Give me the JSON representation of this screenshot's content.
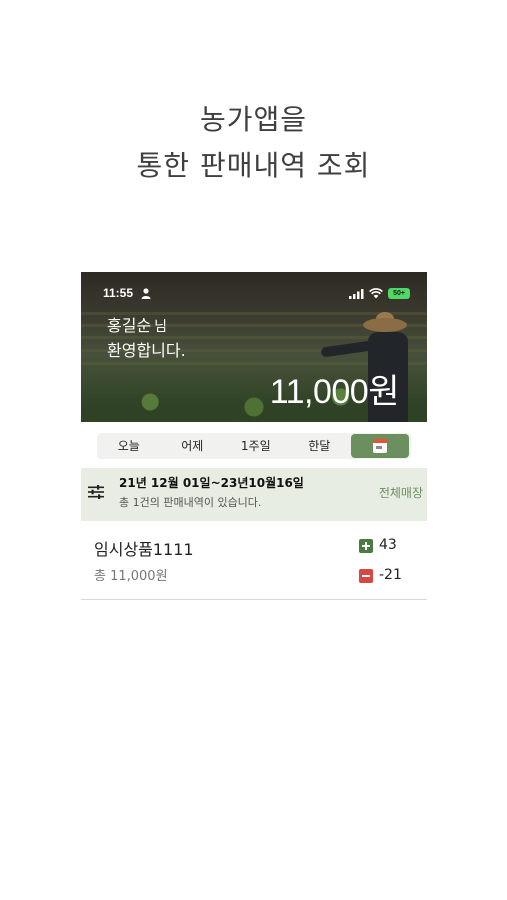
{
  "promo": {
    "line1": "농가앱을",
    "line2": "통한 판매내역 조회"
  },
  "status_bar": {
    "time": "11:55",
    "battery": "50+",
    "icons": [
      "person-icon",
      "signal-icon",
      "wifi-icon",
      "battery-icon"
    ]
  },
  "header": {
    "user_name": "홍길순",
    "name_suffix": "님",
    "welcome": "환영합니다.",
    "total_amount": "11,000원"
  },
  "period_tabs": {
    "items": [
      "오늘",
      "어제",
      "1주일",
      "한달"
    ],
    "selected_icon": "calendar-icon",
    "accent_color": "#6b8f5f"
  },
  "range": {
    "date_range": "21년 12월 01일~23년10월16일",
    "summary": "총  1건의 판매내역이 있습니다.",
    "store_filter": "전체매장",
    "icon": "filter-icon",
    "background": "#e8ede3"
  },
  "sales": [
    {
      "name": "임시상품1111",
      "total": "총 11,000원",
      "plus_count": "43",
      "minus_count": "-21"
    }
  ]
}
